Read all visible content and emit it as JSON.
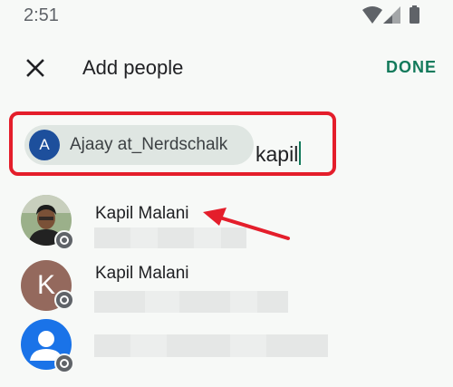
{
  "status_bar": {
    "time": "2:51",
    "icons": [
      "wifi-icon",
      "signal-icon",
      "battery-icon"
    ]
  },
  "header": {
    "title": "Add people",
    "done_label": "DONE",
    "close_icon": "close-icon"
  },
  "recipients": {
    "chip": {
      "initial": "A",
      "label": "Ajaay at_Nerdschalk"
    },
    "query": "kapil"
  },
  "results": [
    {
      "name": "Kapil Malani",
      "avatar": "photo"
    },
    {
      "name": "Kapil Malani",
      "avatar": "letter",
      "initial": "K"
    },
    {
      "name": "",
      "avatar": "default-person-icon"
    }
  ],
  "colors": {
    "accent": "#137a5b",
    "highlight_box": "#e41e2b",
    "arrow": "#e41e2b",
    "chip_avatar": "#1d4f9c"
  }
}
